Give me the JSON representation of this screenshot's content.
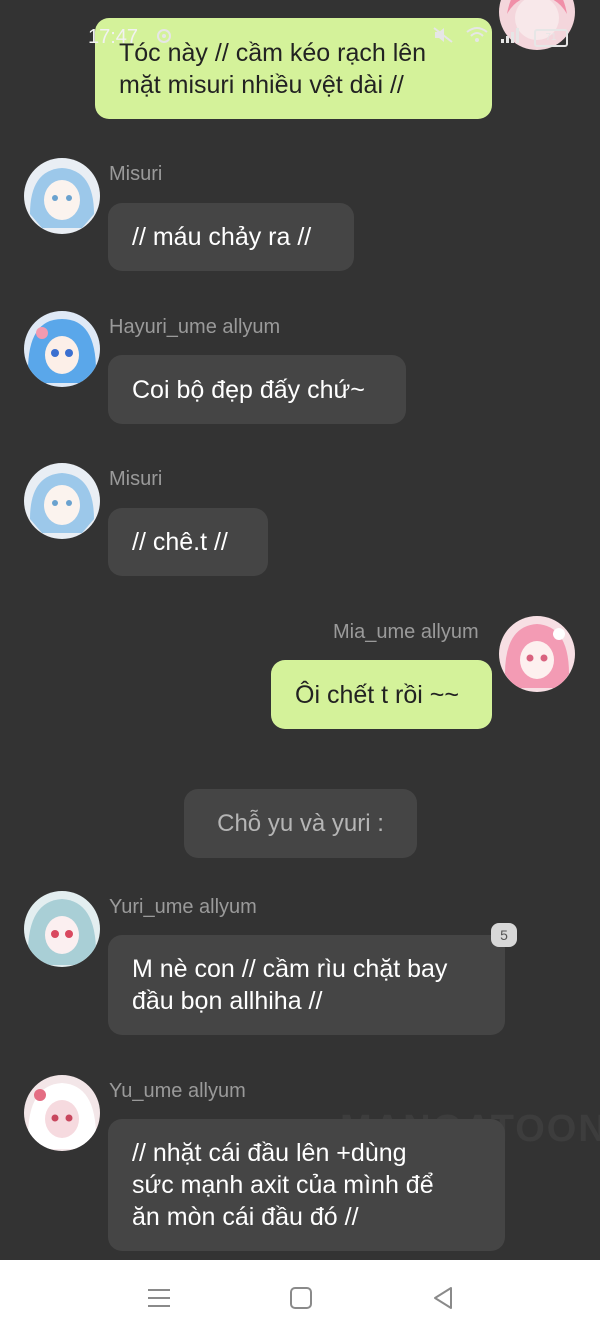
{
  "status_bar": {
    "time": "17:47",
    "battery": "71"
  },
  "watermark": "MANGATOON",
  "messages": [
    {
      "sender": "",
      "lines": [
        "Tóc này // cầm kéo rạch lên",
        "mặt misuri nhiều vệt dài  //"
      ],
      "mine": true
    },
    {
      "sender": "Misuri",
      "lines": [
        "// máu chảy ra //"
      ],
      "mine": false
    },
    {
      "sender": "Hayuri_ume allyum",
      "lines": [
        "Coi bộ đẹp đấy chứ~"
      ],
      "mine": false
    },
    {
      "sender": "Misuri",
      "lines": [
        "// chê.t //"
      ],
      "mine": false
    },
    {
      "sender": "Mia_ume allyum",
      "lines": [
        "Ôi chết t rồi ~~"
      ],
      "mine": true
    },
    {
      "sender": "Yuri_ume allyum",
      "lines": [
        "M nè con // cầm rìu chặt bay",
        "đầu bọn allhiha //"
      ],
      "mine": false,
      "count": "5"
    },
    {
      "sender": "Yu_ume allyum",
      "lines": [
        "// nhặt cái đầu lên +dùng",
        "sức mạnh axit của mình để",
        "ăn mòn cái đầu đó //"
      ],
      "mine": false
    }
  ],
  "system_message": "Chỗ yu và yuri :",
  "colors": {
    "background": "#333333",
    "bubble_other": "#454545",
    "bubble_mine": "#d4f29a"
  }
}
